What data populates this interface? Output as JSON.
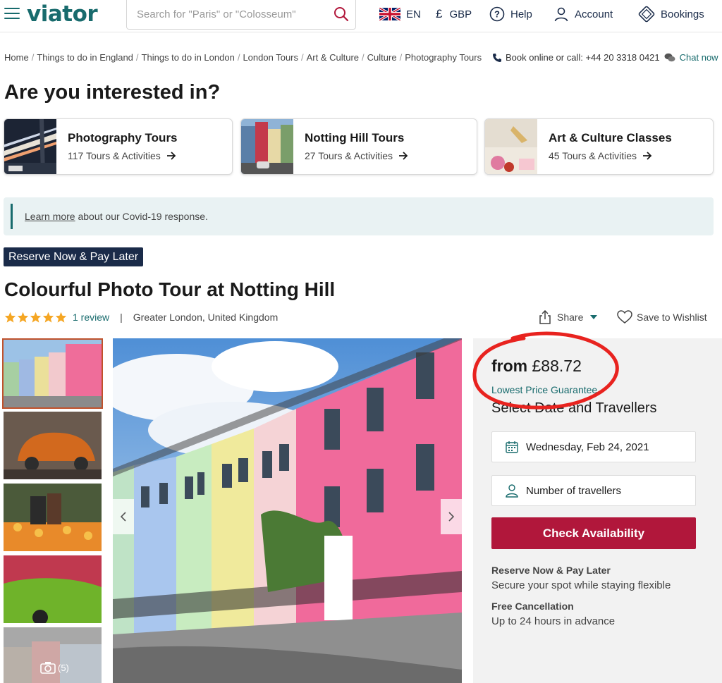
{
  "header": {
    "logo": "viator",
    "search_placeholder": "Search for \"Paris\" or \"Colosseum\"",
    "language": "EN",
    "currency_symbol": "£",
    "currency": "GBP",
    "help": "Help",
    "account": "Account",
    "bookings": "Bookings"
  },
  "breadcrumb": [
    "Home",
    "Things to do in England",
    "Things to do in London",
    "London Tours",
    "Art & Culture",
    "Culture",
    "Photography Tours"
  ],
  "contact": {
    "text": "Book online or call: +44 20 3318 0421",
    "chat": "Chat now"
  },
  "interest_heading": "Are you interested in?",
  "categories": [
    {
      "title": "Photography Tours",
      "count": "117 Tours & Activities"
    },
    {
      "title": "Notting Hill Tours",
      "count": "27 Tours & Activities"
    },
    {
      "title": "Art & Culture Classes",
      "count": "45 Tours & Activities"
    }
  ],
  "covid": {
    "link": "Learn more",
    "text": " about our Covid-19 response."
  },
  "reserve_badge": "Reserve Now & Pay Later",
  "tour_title": "Colourful Photo Tour at Notting Hill",
  "rating": {
    "stars": 5,
    "reviews": "1 review",
    "location": "Greater London, United Kingdom"
  },
  "share": "Share",
  "wishlist": "Save to Wishlist",
  "gallery": {
    "more_count": "(5)"
  },
  "booking": {
    "from": "from",
    "price": "£88.72",
    "guarantee": "Lowest Price Guarantee",
    "select_heading": "Select Date and Travellers",
    "date": "Wednesday, Feb 24, 2021",
    "travellers": "Number of travellers",
    "cta": "Check Availability",
    "reserve_title": "Reserve Now & Pay Later",
    "reserve_sub": "Secure your spot while staying flexible",
    "cancel_title": "Free Cancellation",
    "cancel_sub": "Up to 24 hours in advance"
  },
  "colors": {
    "brand": "#186b6d",
    "cta": "#b1173b",
    "navy": "#1a2b49",
    "star": "#f5a623",
    "annotation": "#e8231f"
  }
}
